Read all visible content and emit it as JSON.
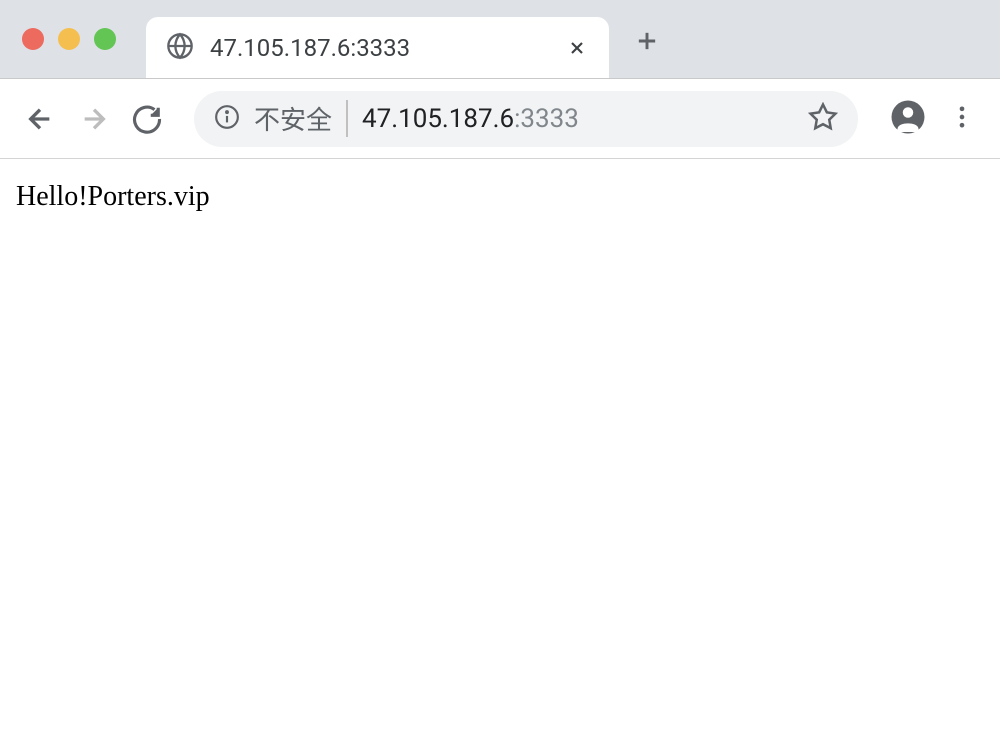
{
  "window": {
    "controls": [
      "close",
      "minimize",
      "maximize"
    ]
  },
  "tab": {
    "title": "47.105.187.6:3333"
  },
  "addressBar": {
    "notSecureLabel": "不安全",
    "urlHost": "47.105.187.6",
    "urlPortSeparator": ":",
    "urlPort": "3333"
  },
  "page": {
    "bodyText": "Hello!Porters.vip"
  }
}
